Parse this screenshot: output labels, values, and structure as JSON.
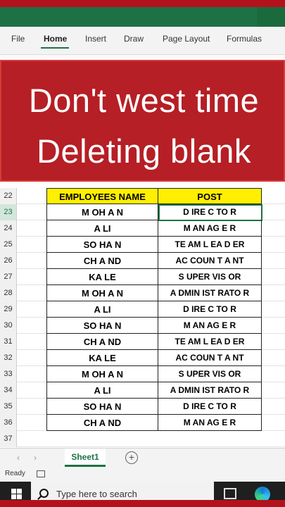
{
  "ribbon": {
    "tabs": [
      "File",
      "Home",
      "Insert",
      "Draw",
      "Page Layout",
      "Formulas"
    ],
    "active_tab": "Home"
  },
  "banner": {
    "line1": "Don't west time",
    "line2": "Deleting blank"
  },
  "table": {
    "header_row_number": "22",
    "headers": {
      "name": "EMPLOYEES NAME",
      "post": "POST"
    },
    "rows": [
      {
        "num": "23",
        "name": "M OH A N",
        "post": "D IRE C TO R"
      },
      {
        "num": "24",
        "name": "A LI",
        "post": "M AN AG E R"
      },
      {
        "num": "25",
        "name": "SO HA N",
        "post": "TE AM L EA D ER"
      },
      {
        "num": "26",
        "name": "CH A ND",
        "post": "AC COUN T A NT"
      },
      {
        "num": "27",
        "name": "KA LE",
        "post": "S UPER VIS OR"
      },
      {
        "num": "28",
        "name": "M OH A N",
        "post": "A DMIN IST RATO R"
      },
      {
        "num": "29",
        "name": "A LI",
        "post": "D IRE C TO R"
      },
      {
        "num": "30",
        "name": "SO HA N",
        "post": "M AN AG E R"
      },
      {
        "num": "31",
        "name": "CH A ND",
        "post": "TE AM L EA D ER"
      },
      {
        "num": "32",
        "name": "KA LE",
        "post": "AC COUN T A NT"
      },
      {
        "num": "33",
        "name": "M OH A N",
        "post": "S UPER VIS OR"
      },
      {
        "num": "34",
        "name": "A LI",
        "post": "A DMIN IST RATO R"
      },
      {
        "num": "35",
        "name": "SO HA N",
        "post": "D IRE C TO R"
      },
      {
        "num": "36",
        "name": "CH A ND",
        "post": "M AN AG E R"
      }
    ],
    "last_row_number": "37"
  },
  "sheet_tabs": {
    "prev_arrow": "‹",
    "next_arrow": "›",
    "active": "Sheet1",
    "add": "+"
  },
  "status": {
    "text": "Ready"
  },
  "taskbar": {
    "search_placeholder": "Type here to search"
  }
}
